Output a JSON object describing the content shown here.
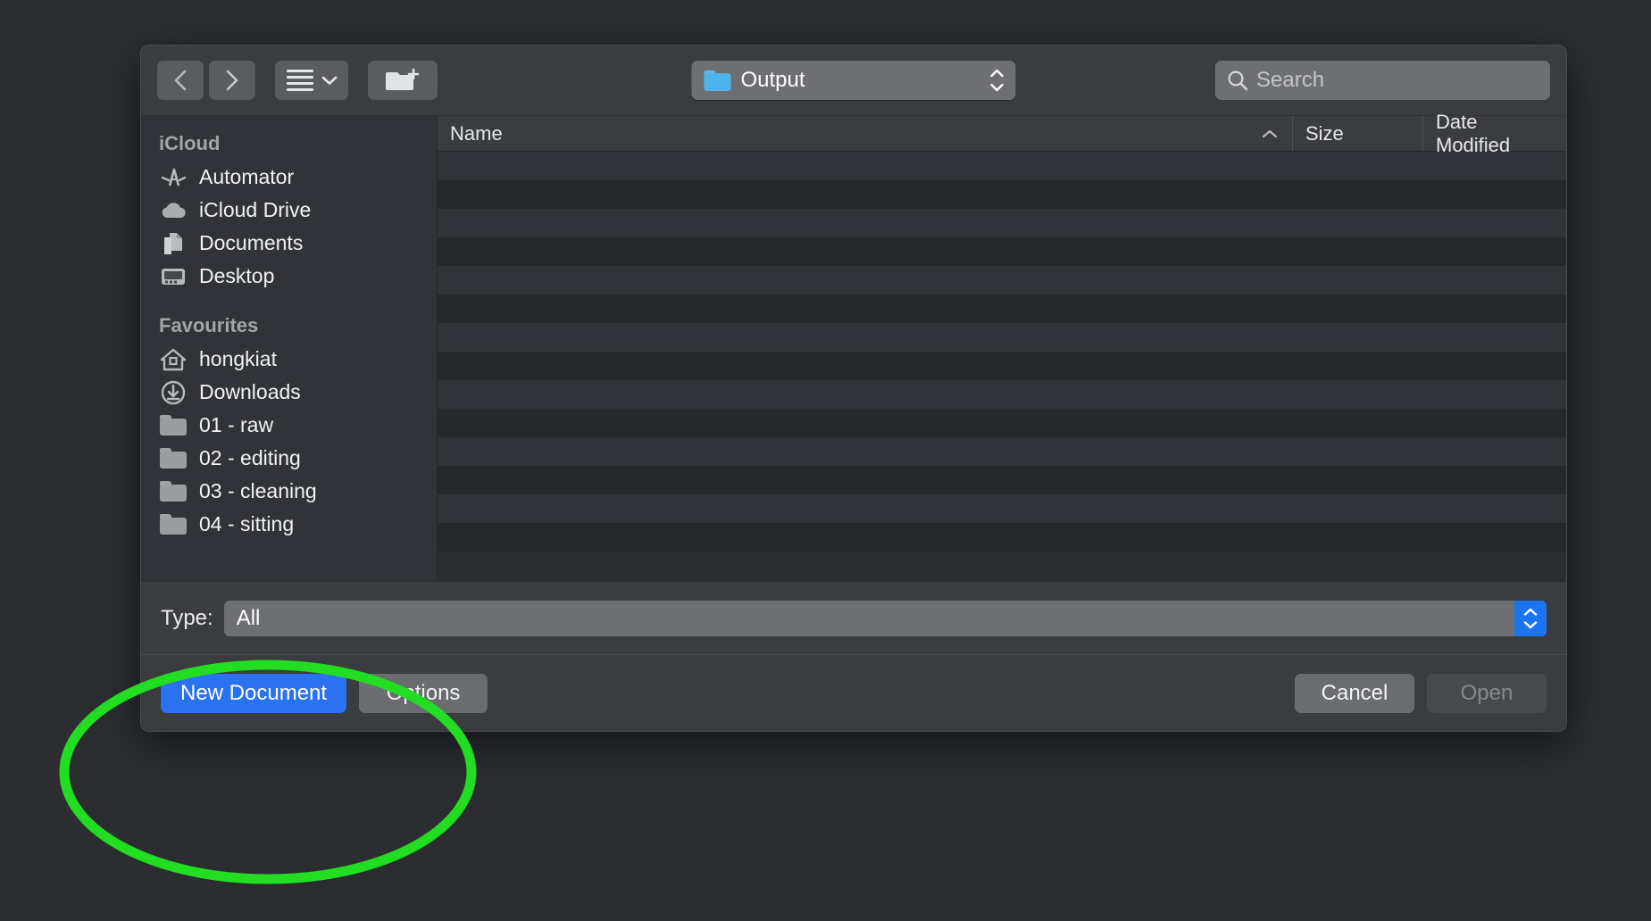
{
  "dialog": {
    "toolbar": {
      "back_icon": "chevron-left-icon",
      "forward_icon": "chevron-right-icon",
      "view_icon": "list-view-icon",
      "view_chevron_icon": "chevron-down-icon",
      "new_folder_icon": "new-folder-icon",
      "path_label": "Output",
      "path_folder_icon": "folder-icon",
      "path_stepper_icon": "stepper-up-down-icon",
      "search_icon": "search-icon",
      "search_value": "",
      "search_placeholder": "Search"
    },
    "sidebar": {
      "sections": [
        {
          "title": "iCloud",
          "items": [
            {
              "label": "Automator",
              "icon": "automator-icon"
            },
            {
              "label": "iCloud Drive",
              "icon": "cloud-icon"
            },
            {
              "label": "Documents",
              "icon": "documents-icon"
            },
            {
              "label": "Desktop",
              "icon": "desktop-icon"
            }
          ]
        },
        {
          "title": "Favourites",
          "items": [
            {
              "label": "hongkiat",
              "icon": "home-icon"
            },
            {
              "label": "Downloads",
              "icon": "downloads-icon"
            },
            {
              "label": "01 - raw",
              "icon": "folder-icon"
            },
            {
              "label": "02 - editing",
              "icon": "folder-icon"
            },
            {
              "label": "03 - cleaning",
              "icon": "folder-icon"
            },
            {
              "label": "04 - sitting",
              "icon": "folder-icon"
            }
          ]
        }
      ]
    },
    "file_list": {
      "columns": [
        {
          "label": "Name",
          "sorted": "ascending",
          "sort_icon": "caret-up-icon"
        },
        {
          "label": "Size"
        },
        {
          "label": "Date Modified"
        }
      ],
      "rows": [],
      "empty": true
    },
    "type_filter": {
      "label": "Type:",
      "value": "All",
      "stepper_icon": "stepper-up-down-icon"
    },
    "actions": {
      "new_document": "New Document",
      "options": "Options",
      "cancel": "Cancel",
      "open": "Open",
      "open_disabled": true
    }
  },
  "annotation": {
    "shape": "ellipse",
    "color": "#22dd22",
    "target": "New Document"
  },
  "colors": {
    "accent_blue": "#2b72f0",
    "folder_blue": "#4db3ec",
    "window_bg": "#3a3c40",
    "sidebar_bg": "#313338",
    "desktop_bg": "#2b2d31",
    "annotation_green": "#22dd22"
  }
}
